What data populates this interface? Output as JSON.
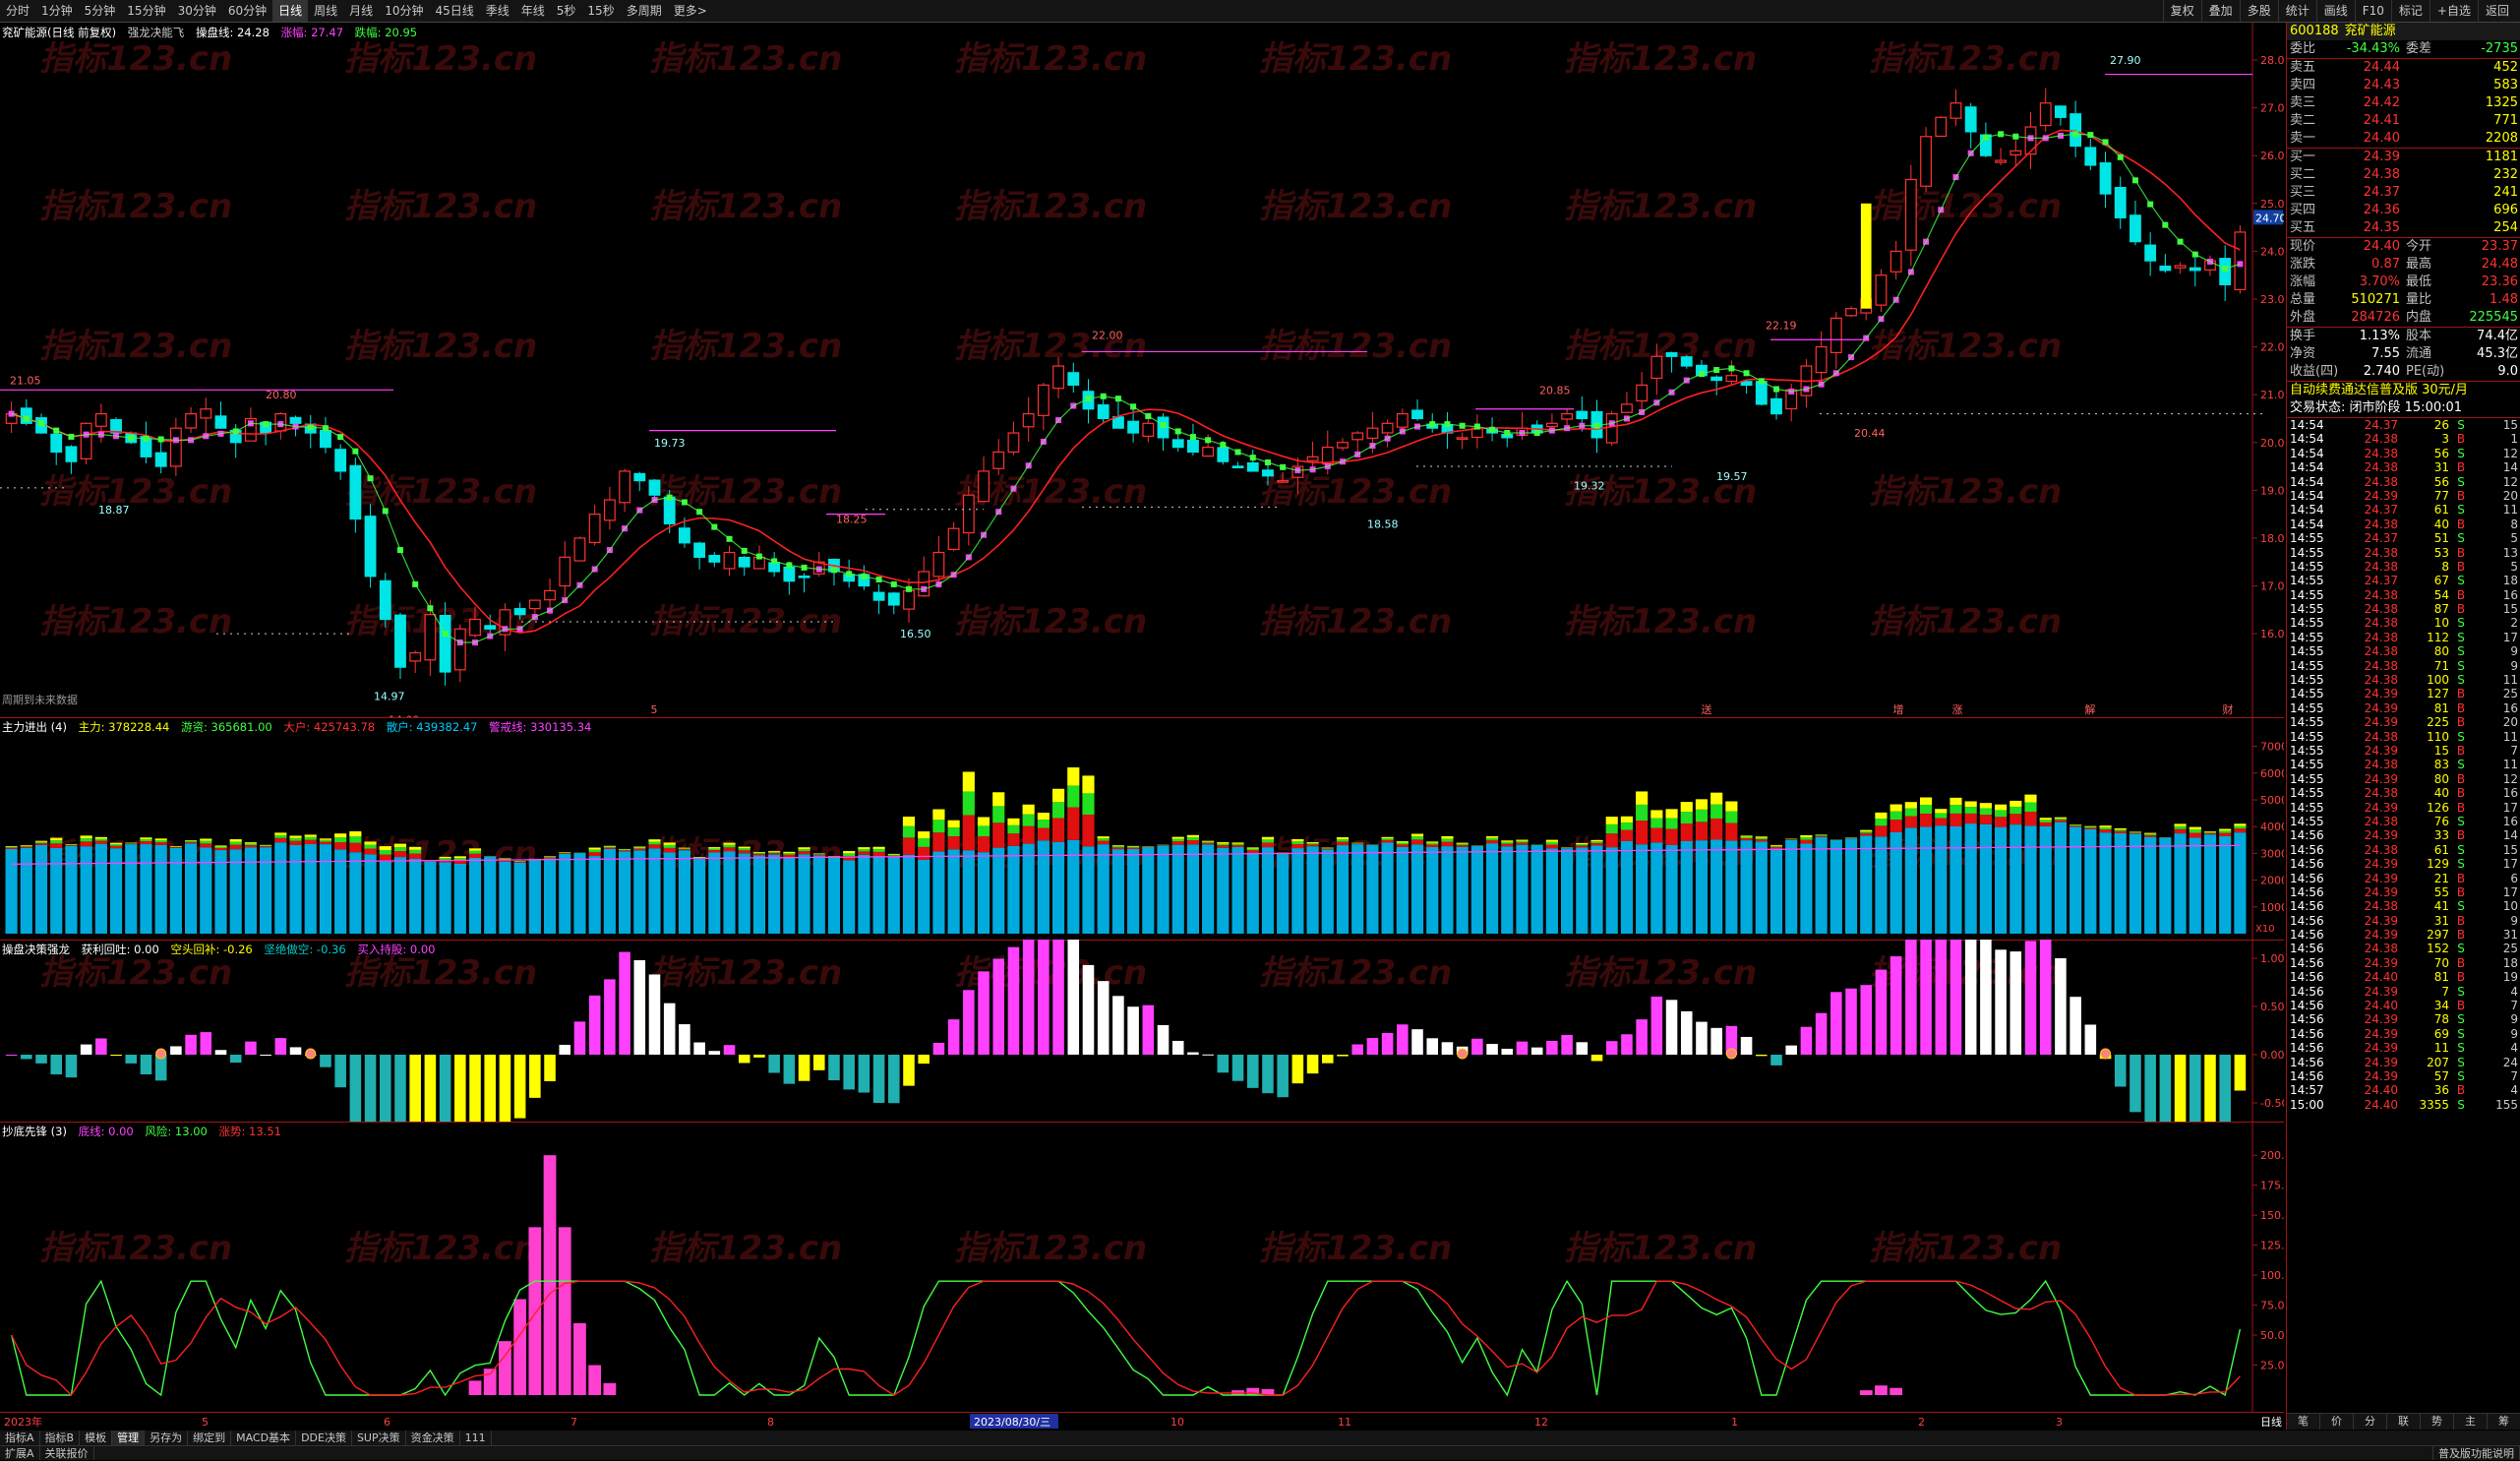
{
  "toolbar": {
    "periods": [
      "分时",
      "1分钟",
      "5分钟",
      "15分钟",
      "30分钟",
      "60分钟",
      "日线",
      "周线",
      "月线",
      "10分钟",
      "45日线",
      "季线",
      "年线",
      "5秒",
      "15秒",
      "多周期",
      "更多>"
    ],
    "active_period": "日线",
    "tools": [
      "复权",
      "叠加",
      "多股",
      "统计",
      "画线",
      "F10",
      "标记",
      "+自选",
      "返回"
    ]
  },
  "main_pane": {
    "title": "兖矿能源(日线 前复权)",
    "indicator": "强龙决能飞",
    "caopan_label": "操盘线: 24.28",
    "zhangfu_label": "涨幅: 27.47",
    "dieshi_label": "跌幅: 20.95",
    "note": "周期到未来数据",
    "price_ticks": [
      "28.00",
      "27.00",
      "26.00",
      "25.00",
      "24.00",
      "23.00",
      "22.00",
      "21.00",
      "20.00",
      "19.00",
      "18.00",
      "17.00",
      "16.00"
    ],
    "current_price_tag": "24.70",
    "annotations": [
      "21.05",
      "18.87",
      "20.80",
      "14.97",
      "14.09",
      "19.73",
      "18.25",
      "16.50",
      "22.00",
      "18.58",
      "20.85",
      "19.32",
      "22.19",
      "19.57",
      "20.44",
      "27.90"
    ],
    "event_marks": [
      "5",
      "送",
      "增",
      "涨",
      "解",
      "财"
    ]
  },
  "pane2": {
    "title": "主力进出 (4)",
    "zhuli_label": "主力: 378228.44",
    "youzi_label": "游资: 365681.00",
    "dahu_label": "大户: 425743.78",
    "sanhu_label": "散户: 439382.47",
    "zhuangxian_label": "警戒线: 330135.34",
    "ticks": [
      "70000",
      "60000",
      "50000",
      "40000",
      "30000",
      "20000",
      "10000"
    ],
    "unit": "X10"
  },
  "pane3": {
    "title": "操盘决策强龙",
    "huoli_label": "获利回吐: 0.00",
    "kongtou_label": "空头回补: -0.26",
    "jueshi_label": "坚绝做空: -0.36",
    "mairu_label": "买入持股: 0.00",
    "ticks": [
      "1.00",
      "0.50",
      "0.00",
      "-0.50"
    ]
  },
  "pane4": {
    "title": "抄底先锋 (3)",
    "dixian_label": "底线: 0.00",
    "fengxian_label": "风险: 13.00",
    "zhangshi_label": "涨势: 13.51",
    "ticks": [
      "200.0",
      "175.0",
      "150.0",
      "125.0",
      "100.0",
      "75.0",
      "50.0",
      "25.0"
    ]
  },
  "date_axis": {
    "labels": [
      "2023年",
      "5",
      "6",
      "7",
      "8",
      "2023/08/30/三",
      "10",
      "11",
      "12",
      "1",
      "2",
      "3"
    ],
    "right_label": "日线"
  },
  "colors": {
    "up": "#ff3232",
    "down": "#00e5e5",
    "pink": "#ff40ff",
    "green": "#40ff40",
    "yellow": "#ffff00",
    "blue": "#00aadd",
    "red": "#e01010",
    "grid": "#a01414",
    "white": "#ffffff"
  },
  "quote": {
    "code": "600188",
    "name": "兖矿能源",
    "weibi_label": "委比",
    "weibi": "-34.43%",
    "weicha_label": "委差",
    "weicha": "-2735",
    "sells": [
      {
        "label": "卖五",
        "price": "24.44",
        "vol": "452"
      },
      {
        "label": "卖四",
        "price": "24.43",
        "vol": "583"
      },
      {
        "label": "卖三",
        "price": "24.42",
        "vol": "1325"
      },
      {
        "label": "卖二",
        "price": "24.41",
        "vol": "771"
      },
      {
        "label": "卖一",
        "price": "24.40",
        "vol": "2208"
      }
    ],
    "buys": [
      {
        "label": "买一",
        "price": "24.39",
        "vol": "1181"
      },
      {
        "label": "买二",
        "price": "24.38",
        "vol": "232"
      },
      {
        "label": "买三",
        "price": "24.37",
        "vol": "241"
      },
      {
        "label": "买四",
        "price": "24.36",
        "vol": "696"
      },
      {
        "label": "买五",
        "price": "24.35",
        "vol": "254"
      }
    ],
    "stats": [
      {
        "l1": "现价",
        "v1": "24.40",
        "l2": "今开",
        "v2": "23.37"
      },
      {
        "l1": "涨跌",
        "v1": "0.87",
        "l2": "最高",
        "v2": "24.48"
      },
      {
        "l1": "涨幅",
        "v1": "3.70%",
        "l2": "最低",
        "v2": "23.36"
      },
      {
        "l1": "总量",
        "v1": "510271",
        "l2": "量比",
        "v2": "1.48"
      },
      {
        "l1": "外盘",
        "v1": "284726",
        "l2": "内盘",
        "v2": "225545"
      }
    ],
    "stats2": [
      {
        "l1": "换手",
        "v1": "1.13%",
        "l2": "股本",
        "v2": "74.4亿"
      },
      {
        "l1": "净资",
        "v1": "7.55",
        "l2": "流通",
        "v2": "45.3亿"
      },
      {
        "l1": "收益(四)",
        "v1": "2.740",
        "l2": "PE(动)",
        "v2": "9.0"
      }
    ],
    "notice": "自动续费通达信普及版 30元/月",
    "status": "交易状态: 闭市阶段 15:00:01",
    "ticks": [
      [
        "14:54",
        "24.37",
        "26",
        "S",
        "15"
      ],
      [
        "14:54",
        "24.38",
        "3",
        "B",
        "1"
      ],
      [
        "14:54",
        "24.38",
        "56",
        "S",
        "12"
      ],
      [
        "14:54",
        "24.38",
        "31",
        "B",
        "14"
      ],
      [
        "14:54",
        "24.38",
        "56",
        "S",
        "12"
      ],
      [
        "14:54",
        "24.39",
        "77",
        "B",
        "20"
      ],
      [
        "14:54",
        "24.37",
        "61",
        "S",
        "11"
      ],
      [
        "14:54",
        "24.38",
        "40",
        "B",
        "8"
      ],
      [
        "14:55",
        "24.37",
        "51",
        "S",
        "5"
      ],
      [
        "14:55",
        "24.38",
        "53",
        "B",
        "13"
      ],
      [
        "14:55",
        "24.38",
        "8",
        "B",
        "5"
      ],
      [
        "14:55",
        "24.37",
        "67",
        "S",
        "18"
      ],
      [
        "14:55",
        "24.38",
        "54",
        "B",
        "16"
      ],
      [
        "14:55",
        "24.38",
        "87",
        "B",
        "15"
      ],
      [
        "14:55",
        "24.38",
        "10",
        "S",
        "2"
      ],
      [
        "14:55",
        "24.38",
        "112",
        "S",
        "17"
      ],
      [
        "14:55",
        "24.38",
        "80",
        "S",
        "9"
      ],
      [
        "14:55",
        "24.38",
        "71",
        "S",
        "9"
      ],
      [
        "14:55",
        "24.38",
        "100",
        "S",
        "11"
      ],
      [
        "14:55",
        "24.39",
        "127",
        "B",
        "25"
      ],
      [
        "14:55",
        "24.39",
        "81",
        "B",
        "16"
      ],
      [
        "14:55",
        "24.39",
        "225",
        "B",
        "20"
      ],
      [
        "14:55",
        "24.38",
        "110",
        "S",
        "11"
      ],
      [
        "14:55",
        "24.39",
        "15",
        "B",
        "7"
      ],
      [
        "14:55",
        "24.38",
        "83",
        "S",
        "11"
      ],
      [
        "14:55",
        "24.39",
        "80",
        "B",
        "12"
      ],
      [
        "14:55",
        "24.38",
        "40",
        "B",
        "16"
      ],
      [
        "14:55",
        "24.39",
        "126",
        "B",
        "17"
      ],
      [
        "14:55",
        "24.38",
        "76",
        "S",
        "16"
      ],
      [
        "14:56",
        "24.39",
        "33",
        "B",
        "14"
      ],
      [
        "14:56",
        "24.38",
        "61",
        "S",
        "15"
      ],
      [
        "14:56",
        "24.39",
        "129",
        "S",
        "17"
      ],
      [
        "14:56",
        "24.39",
        "21",
        "B",
        "6"
      ],
      [
        "14:56",
        "24.39",
        "55",
        "B",
        "17"
      ],
      [
        "14:56",
        "24.38",
        "41",
        "S",
        "10"
      ],
      [
        "14:56",
        "24.39",
        "31",
        "B",
        "9"
      ],
      [
        "14:56",
        "24.39",
        "297",
        "B",
        "31"
      ],
      [
        "14:56",
        "24.38",
        "152",
        "S",
        "25"
      ],
      [
        "14:56",
        "24.39",
        "70",
        "B",
        "18"
      ],
      [
        "14:56",
        "24.40",
        "81",
        "B",
        "19"
      ],
      [
        "14:56",
        "24.39",
        "7",
        "S",
        "4"
      ],
      [
        "14:56",
        "24.40",
        "34",
        "B",
        "7"
      ],
      [
        "14:56",
        "24.39",
        "78",
        "S",
        "9"
      ],
      [
        "14:56",
        "24.39",
        "69",
        "S",
        "9"
      ],
      [
        "14:56",
        "24.39",
        "11",
        "S",
        "4"
      ],
      [
        "14:56",
        "24.39",
        "207",
        "S",
        "24"
      ],
      [
        "14:56",
        "24.39",
        "57",
        "S",
        "7"
      ],
      [
        "14:57",
        "24.40",
        "36",
        "B",
        "4"
      ],
      [
        "15:00",
        "24.40",
        "3355",
        "S",
        "155"
      ]
    ],
    "bottom_tabs": [
      "笔",
      "价",
      "分",
      "联",
      "势",
      "主",
      "筹"
    ]
  },
  "bottom": {
    "tabs1": [
      "指标A",
      "指标B",
      "模板",
      "管理",
      "另存为",
      "绑定到",
      "MACD基本",
      "DDE决策",
      "SUP决策",
      "资金决策",
      "111"
    ],
    "active_tab": "管理",
    "tabs2": [
      "扩展A",
      "关联报价"
    ],
    "right_label": "普及版功能说明"
  },
  "watermark": "指标123.cn"
}
